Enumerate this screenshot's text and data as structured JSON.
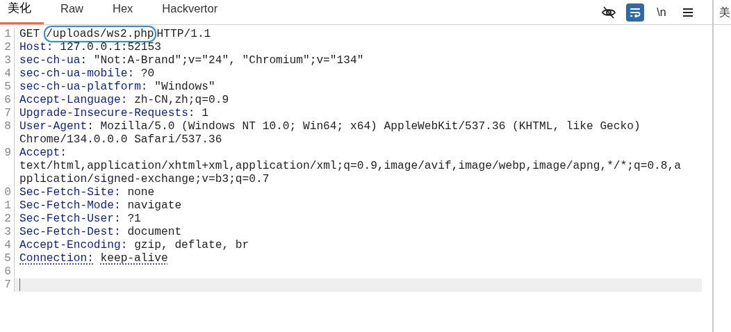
{
  "tabs": [
    {
      "label": "美化",
      "selected": true
    },
    {
      "label": "Raw",
      "selected": false
    },
    {
      "label": "Hex",
      "selected": false
    },
    {
      "label": "Hackvertor",
      "selected": false
    }
  ],
  "toolbar": [
    {
      "kind": "eye-off",
      "selected": false
    },
    {
      "kind": "wrap",
      "selected": true
    },
    {
      "kind": "text",
      "label": "\\n",
      "selected": false
    },
    {
      "kind": "menu",
      "selected": false
    }
  ],
  "editor": {
    "lines": [
      {
        "number": "1",
        "kind": "request",
        "method": "GET",
        "path": "/uploads/ws2.php",
        "path_circled": true,
        "version": "HTTP/1.1"
      },
      {
        "number": "2",
        "kind": "header",
        "key": "Host:",
        "value": "127.0.0.1:52153",
        "underlined": false
      },
      {
        "number": "3",
        "kind": "header",
        "key": "sec-ch-ua:",
        "value": "\"Not:A-Brand\";v=\"24\", \"Chromium\";v=\"134\"",
        "underlined": false
      },
      {
        "number": "4",
        "kind": "header",
        "key": "sec-ch-ua-mobile:",
        "value": "?0",
        "underlined": false
      },
      {
        "number": "5",
        "kind": "header",
        "key": "sec-ch-ua-platform:",
        "value": "\"Windows\"",
        "underlined": false
      },
      {
        "number": "6",
        "kind": "header",
        "key": "Accept-Language:",
        "value": "zh-CN,zh;q=0.9",
        "underlined": false
      },
      {
        "number": "7",
        "kind": "header",
        "key": "Upgrade-Insecure-Requests:",
        "value": "1",
        "underlined": false
      },
      {
        "number": "8",
        "kind": "header",
        "key": "User-Agent:",
        "value": "Mozilla/5.0 (Windows NT 10.0; Win64; x64) AppleWebKit/537.36 (KHTML, like Gecko)",
        "wrapped": [
          "Chrome/134.0.0.0 Safari/537.36"
        ],
        "underlined": false
      },
      {
        "number": "9",
        "kind": "header",
        "key": "Accept:",
        "wrapped": [
          "text/html,application/xhtml+xml,application/xml;q=0.9,image/avif,image/webp,image/apng,*/*;q=0.8,a",
          "pplication/signed-exchange;v=b3;q=0.7"
        ],
        "underlined": false
      },
      {
        "number": "0",
        "kind": "header",
        "key": "Sec-Fetch-Site:",
        "value": "none",
        "underlined": false
      },
      {
        "number": "1",
        "kind": "header",
        "key": "Sec-Fetch-Mode:",
        "value": "navigate",
        "underlined": false
      },
      {
        "number": "2",
        "kind": "header",
        "key": "Sec-Fetch-User:",
        "value": "?1",
        "underlined": false
      },
      {
        "number": "3",
        "kind": "header",
        "key": "Sec-Fetch-Dest:",
        "value": "document",
        "underlined": false
      },
      {
        "number": "4",
        "kind": "header",
        "key": "Accept-Encoding:",
        "value": "gzip, deflate, br",
        "underlined": false
      },
      {
        "number": "5",
        "kind": "header",
        "key": "Connection:",
        "value": "keep-alive",
        "underlined": true
      },
      {
        "number": "6",
        "kind": "blank",
        "current": false
      },
      {
        "number": "7",
        "kind": "blank",
        "current": true
      }
    ]
  },
  "side_panel": {
    "tab": "美"
  }
}
